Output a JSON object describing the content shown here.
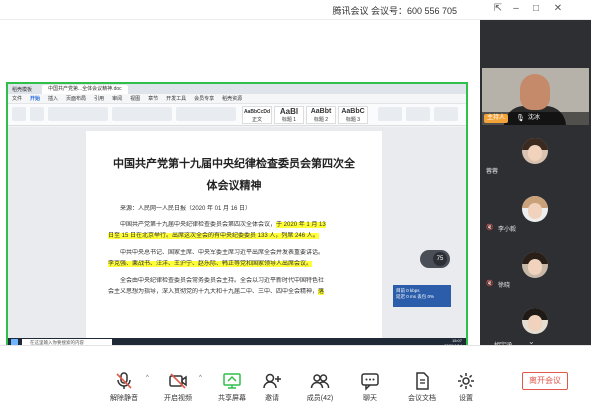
{
  "titlebar": {
    "meeting_text": "腾讯会议 会议号：600 556 705"
  },
  "wps": {
    "tabs": [
      "稻壳模板",
      "中国共产党第...全体会议精神.doc"
    ],
    "menu": [
      "文件",
      "开始",
      "插入",
      "页面布局",
      "引用",
      "审阅",
      "视图",
      "章节",
      "开发工具",
      "会员专享",
      "稻壳资源"
    ],
    "active_menu": "开始",
    "styles": [
      {
        "big": "AaBbCcDd",
        "small": "正文"
      },
      {
        "big": "AaBl",
        "small": "标题 1"
      },
      {
        "big": "AaBbt",
        "small": "标题 2"
      },
      {
        "big": "AaBbC",
        "small": "标题 3"
      }
    ],
    "status": "页码: 1  页面: 1/3  节: 1/1  设置值: 4.5厘米  行: 1  列: 1  字数: 1512  拼写检查  文档校对",
    "zoom": "75"
  },
  "document": {
    "title_line1": "中国共产党第十九届中央纪律检查委员会第四次全",
    "title_line2": "体会议精神",
    "source": "来源：人民网一人民日报（2020 年 01 月 16 日）",
    "p1a": "中国共产党第十九届中央纪律检查委员会第四次全体会议，",
    "p1b": "于 2020 年 1 月 13",
    "p1c": "日至 15 日在北京举行。出席这次全会的有中央纪委委员 133 人，列席 246 人。",
    "p2a": "中共中央总书记、国家主席、中央军委主席习近平出席全会并发表重要讲话。",
    "p2b": "李克强、栗战书、汪洋、王沪宁、赵乐际、韩正等党和国家领导人出席会议。",
    "p3a": "全会由中央纪律检查委员会常务委员会主持。全会以习近平新时代中国特色社",
    "p3b": "会主义思想为指导，深入贯彻党的十九大和十九届二中、三中、四中全会精神，",
    "p3c": "落"
  },
  "overlay": {
    "line1": "目前 0 kbps",
    "line2": "延迟 0 ms  丢包 0%"
  },
  "taskbar": {
    "search_placeholder": "在这里输入你要搜索的内容",
    "time": "15:07",
    "date": "2020/4/14"
  },
  "participants": {
    "presenter": {
      "role": "主持人",
      "name": "沈冰"
    },
    "members": [
      {
        "name": "蓉蓉"
      },
      {
        "name": "李小毅"
      },
      {
        "name": "徐晓"
      },
      {
        "name": "胡宇涵"
      }
    ]
  },
  "toolbar": {
    "mute": "解除静音",
    "video": "开启视频",
    "share": "共享屏幕",
    "invite": "邀请",
    "members": "成员(42)",
    "chat": "聊天",
    "docs": "会议文档",
    "settings": "设置",
    "leave": "离开会议"
  },
  "colors": {
    "speaker_green": "#2fbf4a",
    "highlight": "#ffff3a",
    "leave_red": "#e0594b",
    "host_orange": "#f2a33a"
  }
}
